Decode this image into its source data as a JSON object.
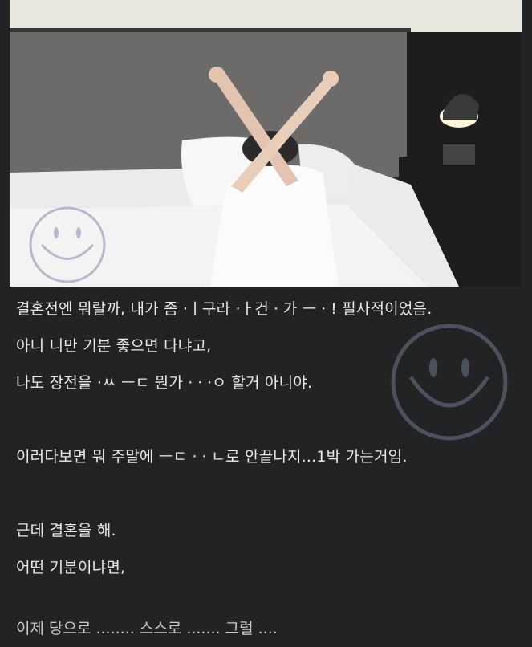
{
  "post": {
    "lines": [
      "결혼전엔 뭐랄까, 내가 좀 ·ㅣ구라 ·ㅏ건ㆍ가 ㅡㆍ! 필사적이었음.",
      "아니 니만 기분 좋으면 다냐고,",
      "나도 장전을 ·ㅆ ㅡㄷ 뭔가 ·ㆍ·ㅇ 할거 아니야.",
      "이러다보면 뭐 주말에 ㅡㄷ ·ㆍㄴ로 안끝나지...1박 가는거임.",
      "근데 결혼을 해.",
      "어떤 기분이냐면,"
    ],
    "cut_line": "이제 당으로 ........ 스스로 ....... 그럴 ...."
  },
  "colors": {
    "background": "#222325",
    "text": "#e9e9ea",
    "watermark": "#7f8aa3"
  },
  "icons": {
    "watermark": "smiley-face-icon",
    "photo_watermark": "smiley-face-icon"
  }
}
